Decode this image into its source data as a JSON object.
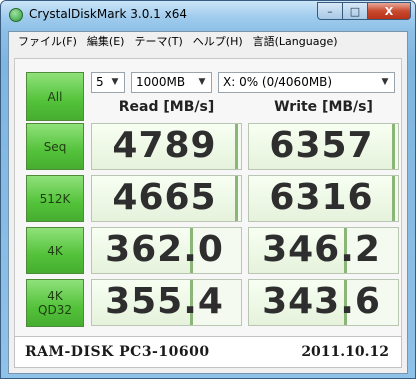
{
  "window": {
    "title": "CrystalDiskMark 3.0.1 x64",
    "minimize_label": "–",
    "maximize_label": "□",
    "close_label": "X"
  },
  "menu": [
    "ファイル(F)",
    "編集(E)",
    "テーマ(T)",
    "ヘルプ(H)",
    "言語(Language)"
  ],
  "controls": {
    "all_label": "All",
    "count": "5",
    "size": "1000MB",
    "drive": "X: 0% (0/4060MB)"
  },
  "headers": {
    "read": "Read [MB/s]",
    "write": "Write [MB/s]"
  },
  "tests": [
    {
      "label": "Seq",
      "read": "4789",
      "write": "6357",
      "read_fill": 0.96,
      "write_fill": 0.96
    },
    {
      "label": "512K",
      "read": "4665",
      "write": "6316",
      "read_fill": 0.96,
      "write_fill": 0.96
    },
    {
      "label": "4K",
      "read": "362.0",
      "write": "346.2",
      "read_fill": 0.66,
      "write_fill": 0.64
    },
    {
      "label": "4K\nQD32",
      "read": "355.4",
      "write": "343.6",
      "read_fill": 0.66,
      "write_fill": 0.64
    }
  ],
  "footer": {
    "comment": "RAM-DISK  PC3-10600",
    "date": "2011.10.12"
  },
  "colors": {
    "button_green": "#53c23a",
    "bar_cap": "#8ab777",
    "title_bg": "#9fcbed"
  }
}
